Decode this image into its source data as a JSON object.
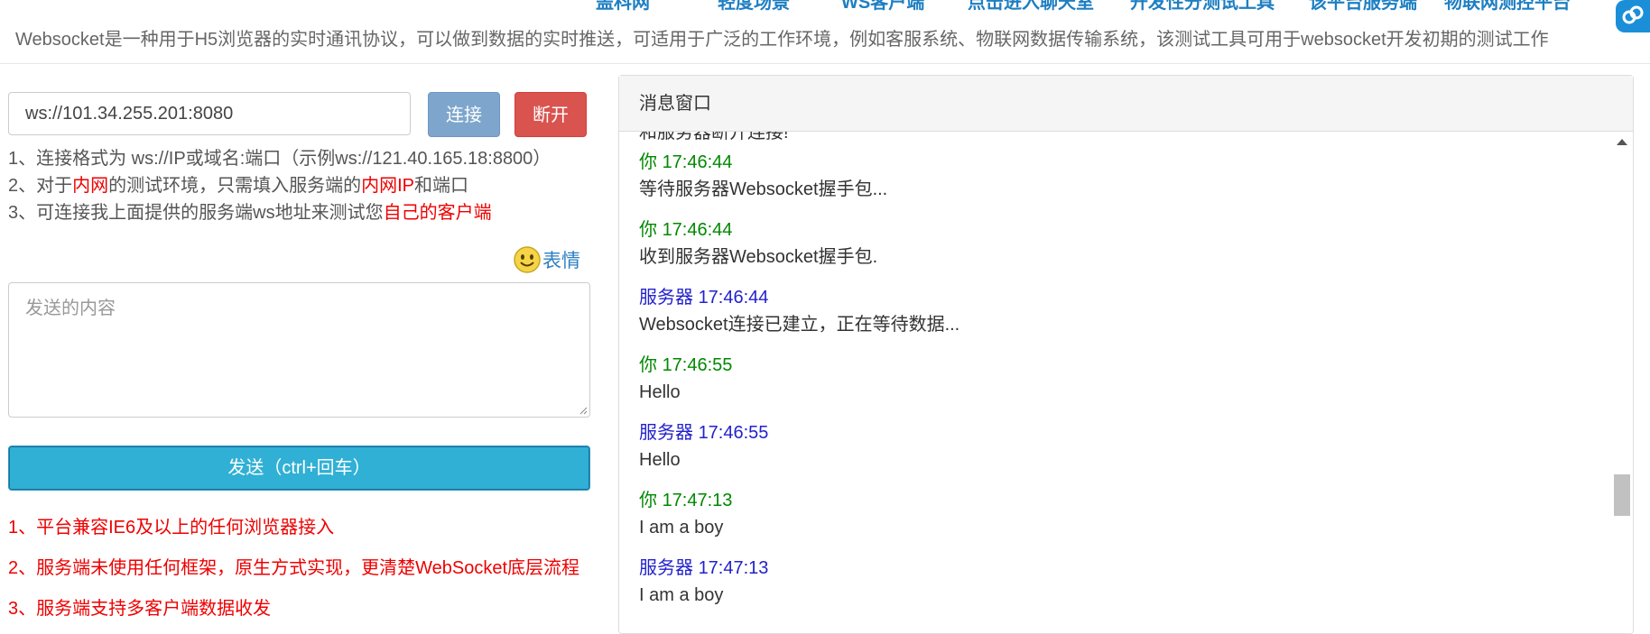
{
  "nav": {
    "items": [
      "盖科网",
      "轻度场景",
      "WS客户端",
      "点击进入聊天室",
      "开发性分测试工具",
      "该平台服务端",
      "物联网测控平台"
    ]
  },
  "intro": "Websocket是一种用于H5浏览器的实时通讯协议，可以做到数据的实时推送，可适用于广泛的工作环境，例如客服系统、物联网数据传输系统，该测试工具可用于websocket开发初期的测试工作",
  "connection": {
    "url": "ws://101.34.255.201:8080",
    "connect_label": "连接",
    "disconnect_label": "断开"
  },
  "notes": {
    "line1": "1、连接格式为 ws://IP或域名:端口（示例ws://121.40.165.18:8800）",
    "line2_a": "2、对于",
    "line2_b": "内网",
    "line2_c": "的测试环境，只需填入服务端的",
    "line2_d": "内网IP",
    "line2_e": "和端口",
    "line3_a": "3、可连接我上面提供的服务端ws地址来测试您",
    "line3_b": "自己的客户端"
  },
  "emoji_label": "表情",
  "composer": {
    "placeholder": "发送的内容",
    "send_label": "发送（ctrl+回车）"
  },
  "features": [
    "1、平台兼容IE6及以上的任何浏览器接入",
    "2、服务端未使用任何框架，原生方式实现，更清楚WebSocket底层流程",
    "3、服务端支持多客户端数据收发"
  ],
  "panel": {
    "title": "消息窗口",
    "partial_line": "和服务器断开连接!",
    "messages": [
      {
        "from": "你",
        "time": "17:46:44",
        "text": "等待服务器Websocket握手包..."
      },
      {
        "from": "你",
        "time": "17:46:44",
        "text": "收到服务器Websocket握手包."
      },
      {
        "from": "服务器",
        "time": "17:46:44",
        "text": "Websocket连接已建立，正在等待数据..."
      },
      {
        "from": "你",
        "time": "17:46:55",
        "text": "Hello"
      },
      {
        "from": "服务器",
        "time": "17:46:55",
        "text": "Hello"
      },
      {
        "from": "你",
        "time": "17:47:13",
        "text": "I am a boy"
      },
      {
        "from": "服务器",
        "time": "17:47:13",
        "text": "I am a boy"
      }
    ]
  },
  "colors": {
    "you": "#008800",
    "server": "#2222cc",
    "highlight": "#ee0000",
    "send_button": "#31b0d5",
    "connect_button": "#7ea6cc",
    "disconnect_button": "#d9534f"
  }
}
